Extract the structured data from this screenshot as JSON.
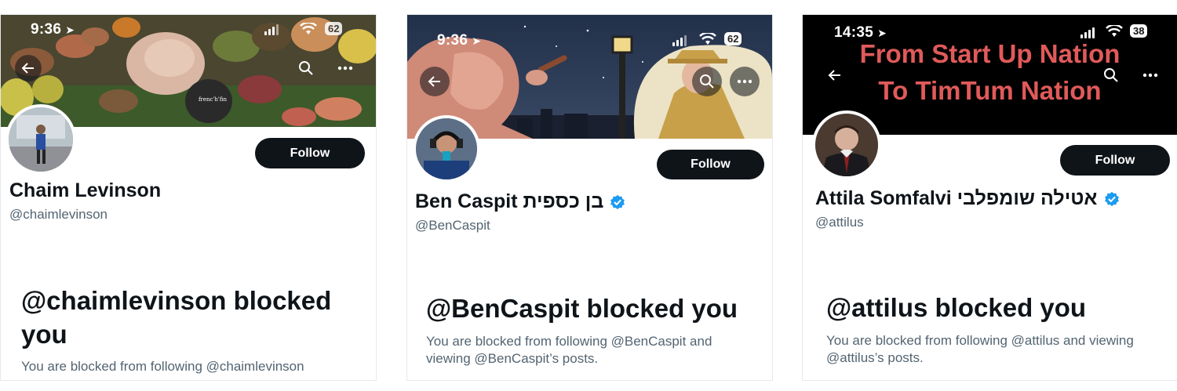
{
  "profiles": [
    {
      "status": {
        "time": "9:36",
        "battery": "62"
      },
      "name": "Chaim Levinson",
      "handle": "@chaimlevinson",
      "follow_label": "Follow",
      "blocked_title": "@chaimlevinson blocked you",
      "blocked_body": "You are blocked from following @chaimlevinson",
      "banner_kind": "food photo",
      "banner_label": "frenc'h'fin",
      "verified": false
    },
    {
      "status": {
        "time": "9:36",
        "battery": "62"
      },
      "name": "Ben Caspit בן כספית",
      "handle": "@BenCaspit",
      "follow_label": "Follow",
      "blocked_title": "@BenCaspit blocked you",
      "blocked_body": "You are blocked from following @BenCaspit and viewing @BenCaspit’s posts.",
      "banner_kind": "illustration",
      "verified": true
    },
    {
      "status": {
        "time": "14:35",
        "battery": "38"
      },
      "name": "Attila Somfalvi אטילה שומפלבי",
      "handle": "@attilus",
      "follow_label": "Follow",
      "blocked_title": "@attilus blocked you",
      "blocked_body": "You are blocked from following @attilus and viewing @attilus’s posts.",
      "banner_line1": "From Start Up Nation",
      "banner_line2": "To TimTum Nation",
      "verified": true
    }
  ],
  "colors": {
    "follow_bg": "#0f1419",
    "verified_blue": "#1d9bf0",
    "banner_text": "#e05a5a",
    "secondary_text": "#536471"
  }
}
